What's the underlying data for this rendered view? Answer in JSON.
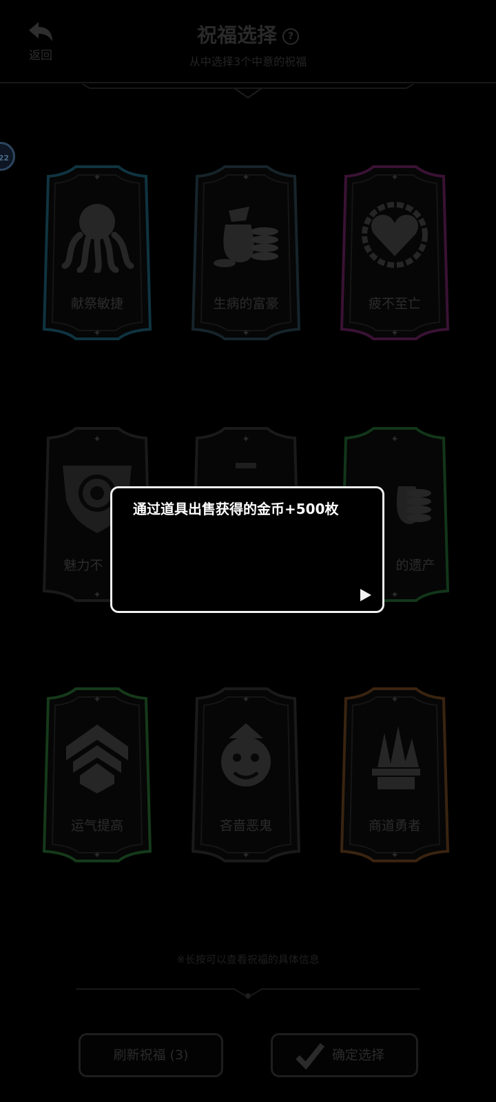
{
  "header": {
    "back_label": "返回",
    "title": "祝福选择",
    "help_symbol": "?",
    "subtitle": "从中选择3个中意的祝福"
  },
  "level_badge": "22",
  "cards": [
    {
      "label": "献祭敏捷",
      "icon": "octopus-icon",
      "glow": "#123a44"
    },
    {
      "label": "生病的富豪",
      "icon": "money-bag-coins-icon",
      "glow": "#16242a"
    },
    {
      "label": "疲不至亡",
      "icon": "chained-heart-icon",
      "glow": "#3a1234"
    },
    {
      "label": "魅力不",
      "icon": "eye-shield-icon",
      "glow": "#1a1a1a"
    },
    {
      "label": "",
      "icon": "hidden-card-icon",
      "glow": "#1a1a1a"
    },
    {
      "label": "的遗产",
      "icon": "money-coins-icon",
      "glow": "#12361a"
    },
    {
      "label": "运气提高",
      "icon": "chevrons-up-icon",
      "glow": "#153a1a"
    },
    {
      "label": "吝啬恶鬼",
      "icon": "clown-icon",
      "glow": "#1a1a1a"
    },
    {
      "label": "商道勇者",
      "icon": "crystals-icon",
      "glow": "#3a2410"
    }
  ],
  "hint": "※长按可以查看祝福的具体信息",
  "buttons": {
    "refresh_label": "刷新祝福 (3)",
    "confirm_label": "确定选择"
  },
  "dialog": {
    "text": "通过道具出售获得的金币+500枚"
  },
  "colors": {
    "dialog_border": "#f2f2f2",
    "background": "#000000"
  }
}
